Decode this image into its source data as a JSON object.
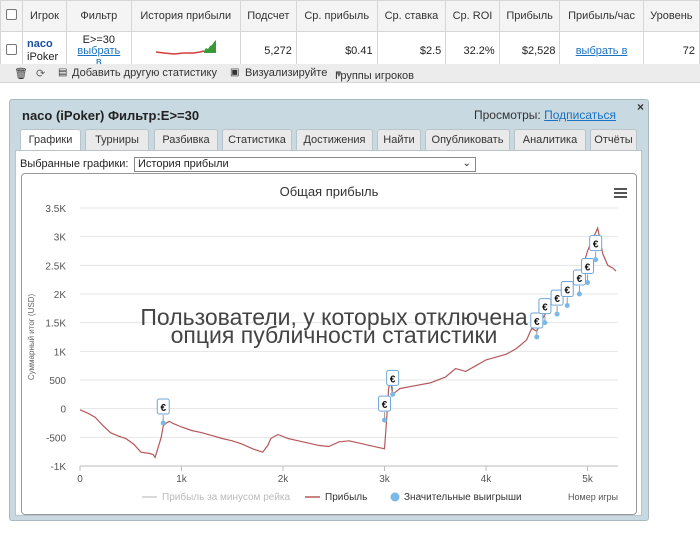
{
  "table": {
    "headers": [
      "Игрок",
      "Фильтр",
      "История прибыли",
      "Подсчет",
      "Ср. прибыль",
      "Ср. ставка",
      "Ср. ROI",
      "Прибыль",
      "Прибыль/час",
      "Уровень"
    ],
    "row": {
      "player_name": "naco",
      "player_site": "iPoker",
      "filter": "E>=30",
      "filter_link": "выбрать в",
      "count": "5,272",
      "avg_profit": "$0.41",
      "avg_stake": "$2.5",
      "avg_roi": "32.2%",
      "profit": "$2,528",
      "profit_per_hour": "выбрать в",
      "level": "72"
    }
  },
  "toolbar": {
    "add_stat": "Добавить другую статистику",
    "visualize": "Визуализируйте",
    "player_groups": "Группы игроков"
  },
  "panel": {
    "title": "naco (iPoker) Фильтр:E>=30",
    "views_label": "Просмотры:",
    "subscribe": "Подписаться",
    "close": "×",
    "tabs": [
      "Графики",
      "Турниры",
      "Разбивка",
      "Статистика",
      "Достижения",
      "Найти",
      "Опубликовать",
      "Аналитика",
      "Отчёты"
    ],
    "graph_select_label": "Выбранные графики:",
    "graph_select_value": "История прибыли",
    "watermark_line1": "Пользователи, у которых отключена",
    "watermark_line2": "опция публичности статистики"
  },
  "colors": {
    "profit_line": "#b5585a",
    "rake_line": "#cccccc",
    "big_win_marker": "#7ab8e6",
    "sparkline_neg": "#d43c3c",
    "sparkline_pos": "#3a9a3a"
  },
  "chart_data": {
    "type": "line",
    "title": "Общая прибыль",
    "ylabel": "Суммарный итог (USD)",
    "xlabel": "Номер игры",
    "xlim": [
      0,
      5300
    ],
    "ylim": [
      -1000,
      3500
    ],
    "x_ticks": [
      "0",
      "1k",
      "2k",
      "3k",
      "4k",
      "5k"
    ],
    "y_ticks": [
      "3.5K",
      "3K",
      "2.5K",
      "2K",
      "1.5K",
      "1K",
      "500",
      "0",
      "-500",
      "-1K"
    ],
    "grid": true,
    "legend_position": "bottom",
    "series": [
      {
        "name": "Прибыль за минусом рейка",
        "color": "#cccccc",
        "hidden": true
      },
      {
        "name": "Прибыль",
        "color": "#b5585a",
        "x": [
          0,
          80,
          150,
          230,
          300,
          380,
          450,
          530,
          600,
          680,
          720,
          740,
          800,
          820,
          850,
          880,
          920,
          1000,
          1100,
          1200,
          1300,
          1400,
          1500,
          1600,
          1700,
          1800,
          1850,
          1880,
          1950,
          2050,
          2150,
          2250,
          2350,
          2450,
          2550,
          2650,
          2750,
          2850,
          2950,
          3000,
          3020,
          3040,
          3060,
          3080,
          3150,
          3300,
          3450,
          3600,
          3700,
          3800,
          3900,
          4000,
          4100,
          4200,
          4300,
          4400,
          4450,
          4500,
          4550,
          4600,
          4650,
          4700,
          4750,
          4800,
          4850,
          4900,
          4950,
          5000,
          5050,
          5100,
          5150,
          5200,
          5250,
          5280
        ],
        "y": [
          -20,
          -80,
          -150,
          -300,
          -420,
          -480,
          -520,
          -620,
          -760,
          -780,
          -800,
          -850,
          -500,
          -300,
          -250,
          -220,
          -260,
          -320,
          -380,
          -420,
          -470,
          -520,
          -560,
          -620,
          -700,
          -760,
          -640,
          -520,
          -450,
          -520,
          -560,
          -600,
          -640,
          -660,
          -580,
          -560,
          -600,
          -640,
          -680,
          -700,
          -200,
          350,
          500,
          250,
          350,
          400,
          450,
          550,
          700,
          650,
          750,
          850,
          900,
          950,
          1050,
          1200,
          1400,
          1350,
          1550,
          1700,
          1850,
          1900,
          2000,
          2050,
          2150,
          2300,
          2450,
          2750,
          2950,
          3150,
          2700,
          2500,
          2450,
          2400
        ]
      },
      {
        "name": "Значительные выигрыши",
        "color": "#7ab8e6",
        "marker": "€",
        "x": [
          820,
          3000,
          3080,
          4500,
          4580,
          4700,
          4800,
          4920,
          5000,
          5080
        ],
        "y": [
          -250,
          -200,
          250,
          1250,
          1500,
          1650,
          1800,
          2000,
          2200,
          2600
        ]
      }
    ]
  }
}
